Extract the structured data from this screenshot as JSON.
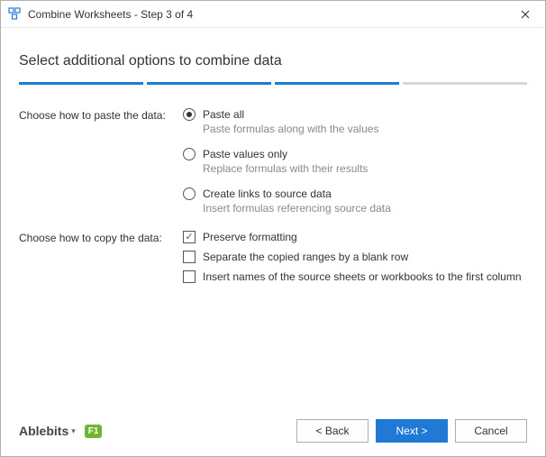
{
  "titlebar": {
    "title": "Combine Worksheets - Step 3 of 4"
  },
  "heading": "Select additional options to combine data",
  "steps": {
    "total": 4,
    "active_until": 3
  },
  "paste_section": {
    "label": "Choose how to paste the data:",
    "options": [
      {
        "label": "Paste all",
        "desc": "Paste formulas along with the values",
        "checked": true
      },
      {
        "label": "Paste values only",
        "desc": "Replace formulas with their results",
        "checked": false
      },
      {
        "label": "Create links to source data",
        "desc": "Insert formulas referencing source data",
        "checked": false
      }
    ]
  },
  "copy_section": {
    "label": "Choose how to copy the data:",
    "options": [
      {
        "label": "Preserve formatting",
        "checked": true
      },
      {
        "label": "Separate the copied ranges by a blank row",
        "checked": false
      },
      {
        "label": "Insert names of the source sheets or workbooks to the first column",
        "checked": false
      }
    ]
  },
  "footer": {
    "brand": "Ablebits",
    "help": "F1",
    "back": "< Back",
    "next": "Next >",
    "cancel": "Cancel"
  }
}
